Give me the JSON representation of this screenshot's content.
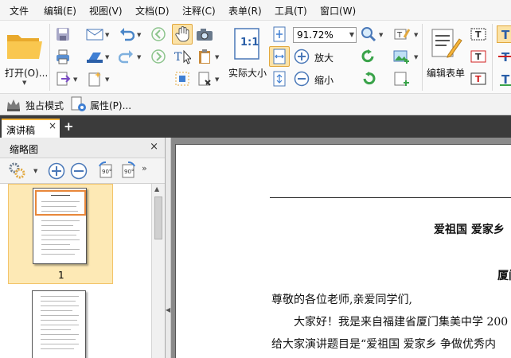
{
  "menubar": {
    "items": [
      "文件",
      "编辑(E)",
      "视图(V)",
      "文档(D)",
      "注释(C)",
      "表单(R)",
      "工具(T)",
      "窗口(W)"
    ]
  },
  "ribbon": {
    "open_label": "打开(O)...",
    "zoom_value": "91.72%",
    "actual_size_label": "实际大小",
    "zoom_in_label": "放大",
    "zoom_out_label": "缩小",
    "edit_form_label": "编辑表单",
    "actual_size_glyph": "1:1"
  },
  "quickbar": {
    "exclusive_mode_label": "独占模式",
    "properties_label": "属性(P)..."
  },
  "tabs": {
    "document_tab_label": "演讲稿",
    "close_glyph": "×",
    "new_tab_glyph": "+"
  },
  "thumbnail_panel": {
    "title": "缩略图",
    "close_glyph": "×",
    "page_numbers": [
      "1"
    ]
  },
  "document": {
    "title_line": "爱祖国  爱家乡",
    "name_fragment": "厦门",
    "salutation": "尊敬的各位老师,亲爱同学们,",
    "para1": "大家好！我是来自福建省厦门集美中学 200",
    "para2": "给大家演讲题目是“爱祖国  爱家乡  争做优秀内"
  },
  "colors": {
    "accent_orange": "#f5b43a",
    "tab_bar": "#3b3b3b",
    "doc_background": "#8a8a8a",
    "selected_thumb_bg": "#fde9b5"
  }
}
